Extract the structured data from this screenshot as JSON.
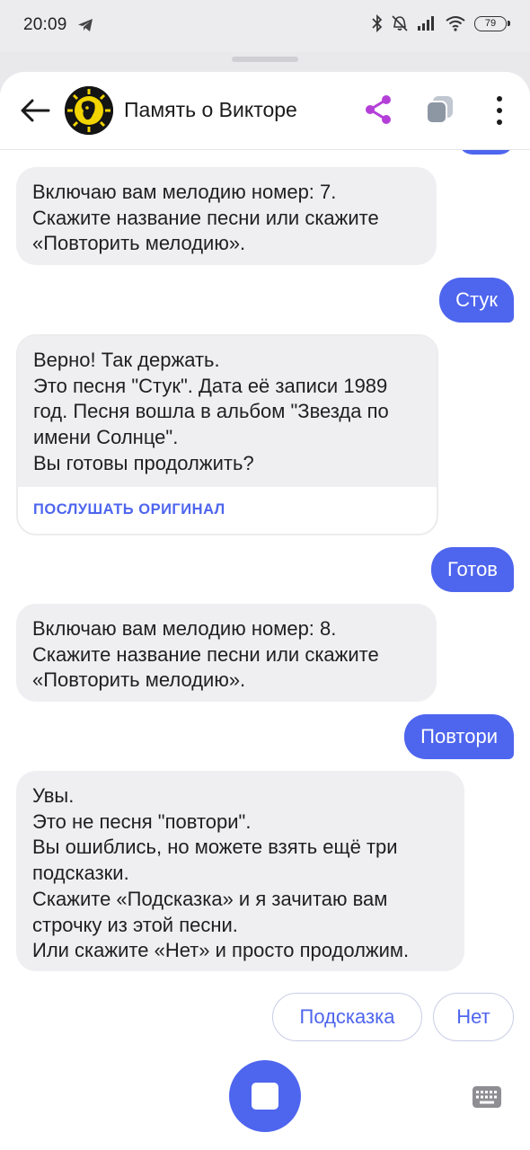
{
  "status_bar": {
    "time": "20:09",
    "battery_level": "79",
    "icons": [
      "telegram-icon",
      "bluetooth-icon",
      "mute-icon",
      "signal-icon",
      "wifi-icon",
      "battery-icon"
    ]
  },
  "header": {
    "title": "Память о Викторе",
    "icons": [
      "back-arrow-icon",
      "avatar",
      "share-icon",
      "copy-icon",
      "more-vertical-icon"
    ],
    "accent_color": "#b43fd8"
  },
  "messages": [
    {
      "from": "bot",
      "lines": [
        "Включаю вам мелодию номер: 7.",
        "Скажите название песни или скажите",
        "«Повторить мелодию»."
      ]
    },
    {
      "from": "user",
      "text": "Стук"
    },
    {
      "from": "bot",
      "lines": [
        "Верно! Так держать.",
        "Это песня \"Стук\". Дата её записи 1989",
        "год. Песня вошла в альбом \"Звезда по",
        "имени Солнце\".",
        "Вы готовы продолжить?"
      ],
      "action": "ПОСЛУШАТЬ ОРИГИНАЛ"
    },
    {
      "from": "user",
      "text": "Готов"
    },
    {
      "from": "bot",
      "lines": [
        "Включаю вам мелодию номер: 8.",
        "Скажите название песни или скажите",
        "«Повторить мелодию»."
      ]
    },
    {
      "from": "user",
      "text": "Повтори"
    },
    {
      "from": "bot",
      "lines": [
        "Увы.",
        "Это не песня \"повтори\".",
        "Вы ошиблись, но можете взять ещё три",
        "подсказки.",
        "Скажите «Подсказка» и я зачитаю вам",
        "строчку из этой песни.",
        "Или скажите «Нет» и просто продолжим."
      ]
    }
  ],
  "suggestions": [
    "Подсказка",
    "Нет"
  ],
  "bottom": {
    "icons": [
      "stop-listening-icon",
      "keyboard-icon"
    ]
  },
  "colors": {
    "primary": "#4e65ee",
    "bot_bubble": "#efeff2",
    "background": "#ffffff"
  }
}
